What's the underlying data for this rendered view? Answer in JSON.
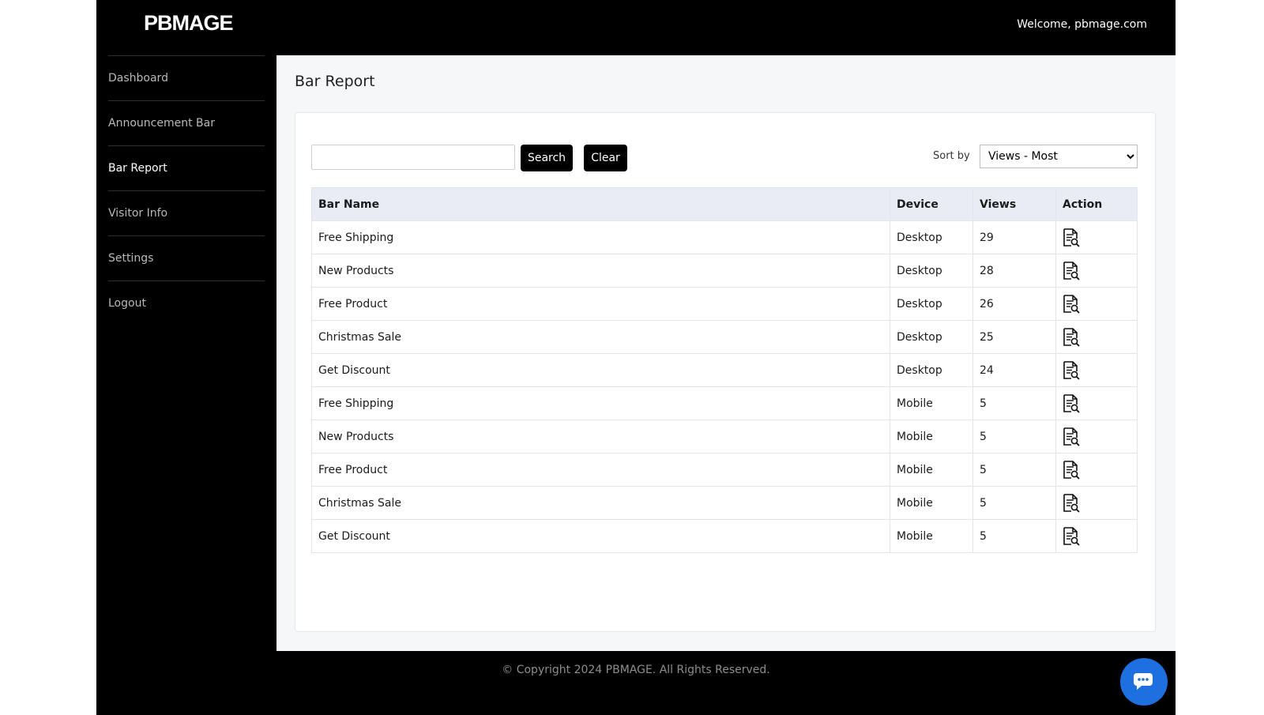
{
  "header": {
    "logo": "PBMAGE",
    "welcome": "Welcome, pbmage.com"
  },
  "sidebar": {
    "items": [
      {
        "label": "Dashboard",
        "active": false
      },
      {
        "label": "Announcement Bar",
        "active": false
      },
      {
        "label": "Bar Report",
        "active": true
      },
      {
        "label": "Visitor Info",
        "active": false
      },
      {
        "label": "Settings",
        "active": false
      },
      {
        "label": "Logout",
        "active": false
      }
    ]
  },
  "main": {
    "title": "Bar Report",
    "search": {
      "value": "",
      "placeholder": "",
      "search_label": "Search",
      "clear_label": "Clear"
    },
    "sort": {
      "label": "Sort by",
      "selected": "Views - Most"
    },
    "table": {
      "headers": [
        "Bar Name",
        "Device",
        "Views",
        "Action"
      ],
      "rows": [
        {
          "name": "Free Shipping",
          "device": "Desktop",
          "views": "29"
        },
        {
          "name": "New Products",
          "device": "Desktop",
          "views": "28"
        },
        {
          "name": "Free Product",
          "device": "Desktop",
          "views": "26"
        },
        {
          "name": "Christmas Sale",
          "device": "Desktop",
          "views": "25"
        },
        {
          "name": "Get Discount",
          "device": "Desktop",
          "views": "24"
        },
        {
          "name": "Free Shipping",
          "device": "Mobile",
          "views": "5"
        },
        {
          "name": "New Products",
          "device": "Mobile",
          "views": "5"
        },
        {
          "name": "Free Product",
          "device": "Mobile",
          "views": "5"
        },
        {
          "name": "Christmas Sale",
          "device": "Mobile",
          "views": "5"
        },
        {
          "name": "Get Discount",
          "device": "Mobile",
          "views": "5"
        }
      ],
      "action_icon": "report-view-icon"
    }
  },
  "footer": {
    "copyright": "© Copyright 2024 PBMAGE. All Rights Reserved."
  },
  "chat": {
    "icon": "chat-icon",
    "color": "#1e6fe0"
  }
}
